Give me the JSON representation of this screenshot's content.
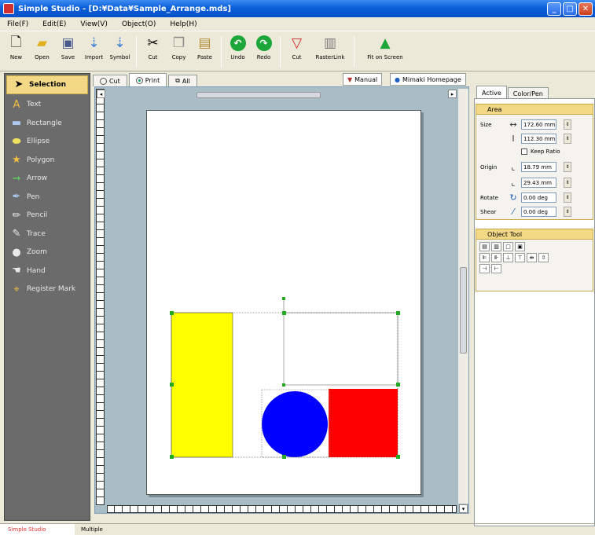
{
  "window": {
    "title": "Simple Studio - [D:¥Data¥Sample_Arrange.mds]"
  },
  "menu": [
    "File(F)",
    "Edit(E)",
    "View(V)",
    "Object(O)",
    "Help(H)"
  ],
  "toolbar": {
    "new": "New",
    "open": "Open",
    "save": "Save",
    "import": "Import",
    "symbol": "Symbol",
    "cut": "Cut",
    "copy": "Copy",
    "paste": "Paste",
    "undo": "Undo",
    "redo": "Redo",
    "cut2": "Cut",
    "rasterlink": "RasterLink",
    "fit": "Fit on Screen"
  },
  "tools": [
    "Selection",
    "Text",
    "Rectangle",
    "Ellipse",
    "Polygon",
    "Arrow",
    "Pen",
    "Pencil",
    "Trace",
    "Zoom",
    "Hand",
    "Register Mark"
  ],
  "doc_tabs": {
    "cut": "Cut",
    "print": "Print",
    "all": "All",
    "manual": "Manual",
    "homepage": "Mimaki Homepage"
  },
  "panel": {
    "tabs": [
      "Active",
      "Color/Pen"
    ],
    "area": {
      "title": "Area",
      "size_label": "Size",
      "width": "172.60 mm",
      "height": "112.30 mm",
      "keep_ratio": "Keep Ratio",
      "origin_label": "Origin",
      "origin_x": "18.79 mm",
      "origin_y": "29.43 mm",
      "rotate_label": "Rotate",
      "rotate": "0.00 deg",
      "shear_label": "Shear",
      "shear": "0.00 deg"
    },
    "object_tool": {
      "title": "Object Tool"
    }
  },
  "shapes": {
    "yellow": "#ffff00",
    "blue": "#0000ff",
    "red": "#ff0000",
    "handle": "#22aa22"
  },
  "status": {
    "app": "Simple Studio",
    "selection": "Multiple"
  }
}
